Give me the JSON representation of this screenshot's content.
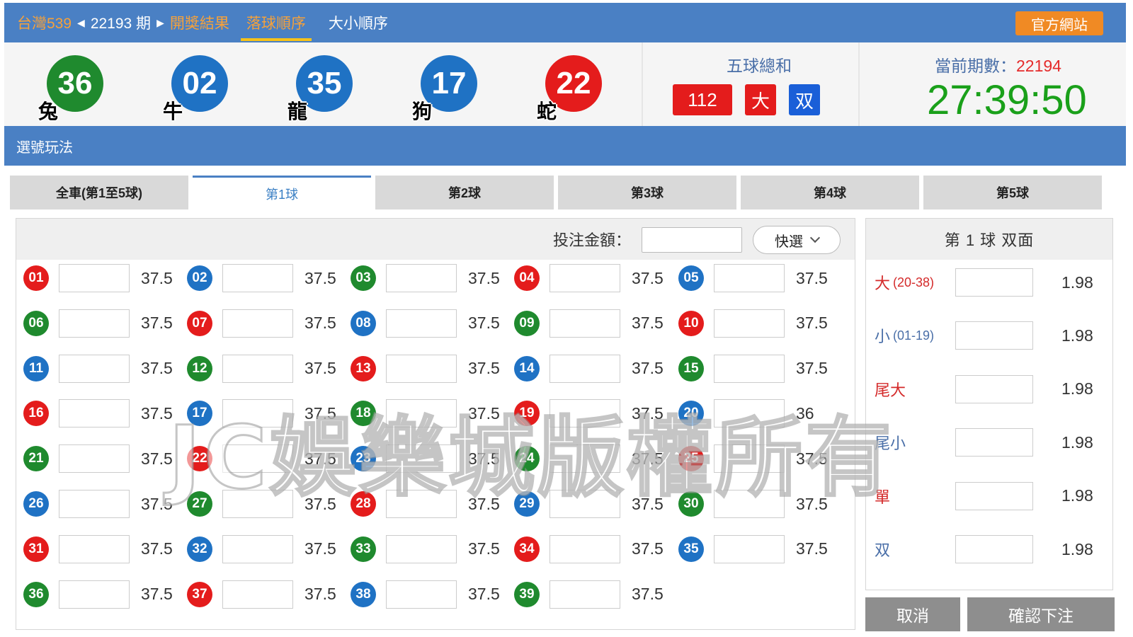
{
  "topbar": {
    "lottery": "台灣539",
    "period": "22193 期",
    "nav": [
      "開獎結果",
      "落球順序",
      "大小順序"
    ],
    "official_site": "官方網站"
  },
  "results": [
    {
      "number": "36",
      "zodiac": "兔",
      "color": "green"
    },
    {
      "number": "02",
      "zodiac": "牛",
      "color": "blue"
    },
    {
      "number": "35",
      "zodiac": "龍",
      "color": "blue"
    },
    {
      "number": "17",
      "zodiac": "狗",
      "color": "blue"
    },
    {
      "number": "22",
      "zodiac": "蛇",
      "color": "red"
    }
  ],
  "sum": {
    "title": "五球總和",
    "total": "112",
    "size": "大",
    "parity": "双"
  },
  "current": {
    "label": "當前期數：",
    "period": "22194",
    "countdown": "27:39:50"
  },
  "section_title": "選號玩法",
  "tabs": [
    "全車(第1至5球)",
    "第1球",
    "第2球",
    "第3球",
    "第4球",
    "第5球"
  ],
  "active_tab": 1,
  "bet": {
    "amount_label": "投注金額：",
    "quick_label": "快選",
    "balls": [
      {
        "n": "01",
        "c": "red",
        "o": "37.5"
      },
      {
        "n": "02",
        "c": "blue",
        "o": "37.5"
      },
      {
        "n": "03",
        "c": "green",
        "o": "37.5"
      },
      {
        "n": "04",
        "c": "red",
        "o": "37.5"
      },
      {
        "n": "05",
        "c": "blue",
        "o": "37.5"
      },
      {
        "n": "06",
        "c": "green",
        "o": "37.5"
      },
      {
        "n": "07",
        "c": "red",
        "o": "37.5"
      },
      {
        "n": "08",
        "c": "blue",
        "o": "37.5"
      },
      {
        "n": "09",
        "c": "green",
        "o": "37.5"
      },
      {
        "n": "10",
        "c": "red",
        "o": "37.5"
      },
      {
        "n": "11",
        "c": "blue",
        "o": "37.5"
      },
      {
        "n": "12",
        "c": "green",
        "o": "37.5"
      },
      {
        "n": "13",
        "c": "red",
        "o": "37.5"
      },
      {
        "n": "14",
        "c": "blue",
        "o": "37.5"
      },
      {
        "n": "15",
        "c": "green",
        "o": "37.5"
      },
      {
        "n": "16",
        "c": "red",
        "o": "37.5"
      },
      {
        "n": "17",
        "c": "blue",
        "o": "37.5"
      },
      {
        "n": "18",
        "c": "green",
        "o": "37.5"
      },
      {
        "n": "19",
        "c": "red",
        "o": "37.5"
      },
      {
        "n": "20",
        "c": "blue",
        "o": "36"
      },
      {
        "n": "21",
        "c": "green",
        "o": "37.5"
      },
      {
        "n": "22",
        "c": "red",
        "o": "37.5"
      },
      {
        "n": "23",
        "c": "blue",
        "o": "37.5"
      },
      {
        "n": "24",
        "c": "green",
        "o": "37.5"
      },
      {
        "n": "25",
        "c": "red",
        "o": "37.5"
      },
      {
        "n": "26",
        "c": "blue",
        "o": "37.5"
      },
      {
        "n": "27",
        "c": "green",
        "o": "37.5"
      },
      {
        "n": "28",
        "c": "red",
        "o": "37.5"
      },
      {
        "n": "29",
        "c": "blue",
        "o": "37.5"
      },
      {
        "n": "30",
        "c": "green",
        "o": "37.5"
      },
      {
        "n": "31",
        "c": "red",
        "o": "37.5"
      },
      {
        "n": "32",
        "c": "blue",
        "o": "37.5"
      },
      {
        "n": "33",
        "c": "green",
        "o": "37.5"
      },
      {
        "n": "34",
        "c": "red",
        "o": "37.5"
      },
      {
        "n": "35",
        "c": "blue",
        "o": "37.5"
      },
      {
        "n": "36",
        "c": "green",
        "o": "37.5"
      },
      {
        "n": "37",
        "c": "red",
        "o": "37.5"
      },
      {
        "n": "38",
        "c": "blue",
        "o": "37.5"
      },
      {
        "n": "39",
        "c": "green",
        "o": "37.5"
      }
    ]
  },
  "side": {
    "title": "第 1 球 双面",
    "rows": [
      {
        "label": "大",
        "sub": "(20-38)",
        "tone": "red",
        "odds": "1.98"
      },
      {
        "label": "小",
        "sub": "(01-19)",
        "tone": "blue",
        "odds": "1.98"
      },
      {
        "label": "尾大",
        "sub": "",
        "tone": "red",
        "odds": "1.98"
      },
      {
        "label": "尾小",
        "sub": "",
        "tone": "blue",
        "odds": "1.98"
      },
      {
        "label": "單",
        "sub": "",
        "tone": "red",
        "odds": "1.98"
      },
      {
        "label": "双",
        "sub": "",
        "tone": "blue",
        "odds": "1.98"
      }
    ]
  },
  "buttons": {
    "cancel": "取消",
    "confirm": "確認下注"
  },
  "watermark": "JC娛樂城版權所有",
  "colors": {
    "red": "#e41c1c",
    "blue": "#1f72c4",
    "green": "#1f8a2e",
    "header_blue": "#4a80c4",
    "accent_orange": "#f08a24"
  }
}
